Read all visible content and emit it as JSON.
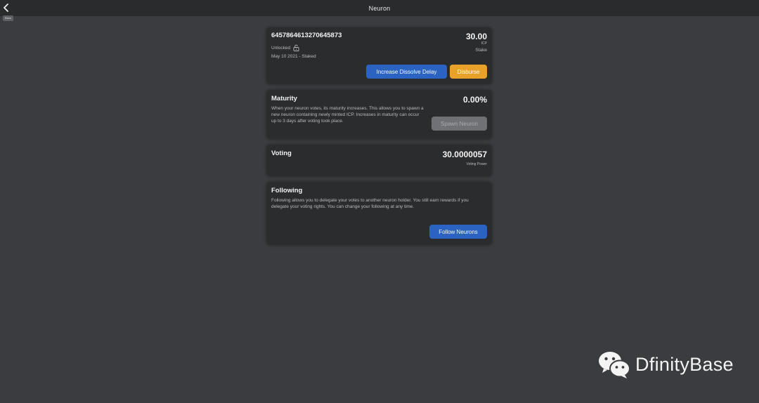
{
  "header": {
    "title": "Neuron",
    "back_label": "Back"
  },
  "neuron": {
    "id": "6457864613270645873",
    "state": "Unlocked",
    "date_staked": "May 10 2021 - Staked",
    "stake_amount": "30.00",
    "stake_unit": "ICP",
    "stake_label": "Stake",
    "increase_dissolve_label": "Increase Dissolve Delay",
    "disburse_label": "Disburse"
  },
  "maturity": {
    "title": "Maturity",
    "value": "0.00%",
    "description": "When your neuron votes, its maturity increases. This allows you to spawn a new neuron containing newly minted ICP. Increases in maturity can occur up to 3 days after voting took place.",
    "spawn_label": "Spawn Neuron"
  },
  "voting": {
    "title": "Voting",
    "value": "30.0000057",
    "label": "Voting Power"
  },
  "following": {
    "title": "Following",
    "description": "Following allows you to delegate your votes to another neuron holder. You still earn rewards if you delegate your voting rights. You can change your following at any time.",
    "follow_label": "Follow Neurons"
  },
  "watermark": {
    "text": "DfinityBase"
  },
  "colors": {
    "background": "#3b3c3f",
    "card": "#2b2c2e",
    "primary_blue": "#2a63c1",
    "disburse_orange": "#e8a129",
    "disabled_grey": "#6f7174"
  },
  "icons": {
    "back": "chevron-left-icon",
    "lock": "lock-open-icon",
    "watermark": "wechat-icon"
  }
}
